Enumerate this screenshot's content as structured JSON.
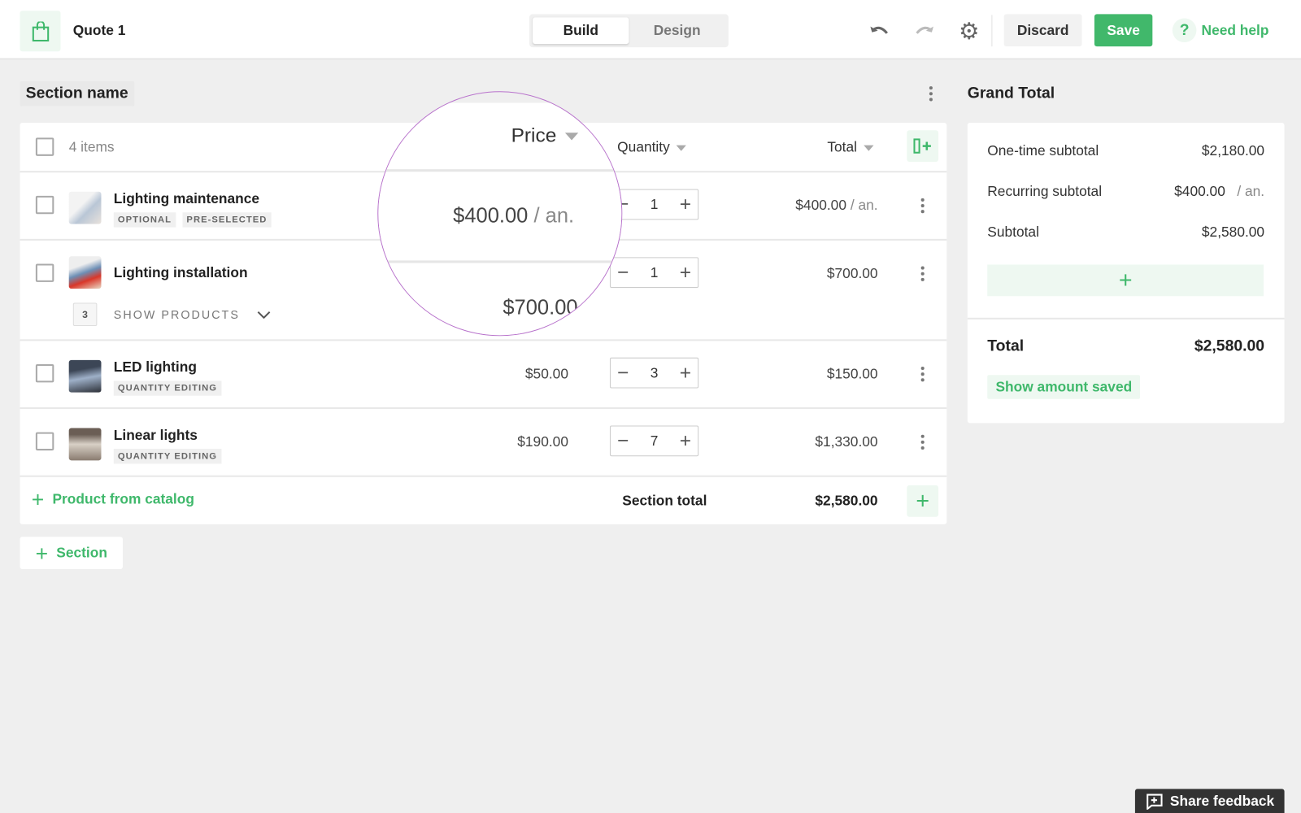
{
  "header": {
    "title": "Quote 1",
    "tabs": [
      {
        "label": "Build",
        "active": true
      },
      {
        "label": "Design",
        "active": false
      }
    ],
    "discard": "Discard",
    "save": "Save",
    "help": "Need help",
    "help_icon": "?"
  },
  "section": {
    "name": "Section name",
    "items_count": "4 items",
    "columns": {
      "price": "Price",
      "quantity": "Quantity",
      "total": "Total"
    },
    "rows": [
      {
        "name": "Lighting maintenance",
        "tags": [
          "OPTIONAL",
          "PRE-SELECTED"
        ],
        "price": "$400.00",
        "price_suffix": "/ an.",
        "qty": "1",
        "total": "$400.00",
        "total_suffix": "/ an."
      },
      {
        "name": "Lighting installation",
        "price": "$700.00",
        "qty": "1",
        "total": "$700.00",
        "bundle_count": "3",
        "show_products": "SHOW PRODUCTS"
      },
      {
        "name": "LED lighting",
        "tags": [
          "QUANTITY EDITING"
        ],
        "price": "$50.00",
        "qty": "3",
        "total": "$150.00"
      },
      {
        "name": "Linear lights",
        "tags": [
          "QUANTITY EDITING"
        ],
        "price": "$190.00",
        "qty": "7",
        "total": "$1,330.00"
      }
    ],
    "add_product": "Product from catalog",
    "section_total_label": "Section total",
    "section_total": "$2,580.00",
    "add_section": "Section"
  },
  "grand_total": {
    "title": "Grand Total",
    "one_time_label": "One-time subtotal",
    "one_time": "$2,180.00",
    "recurring_label": "Recurring subtotal",
    "recurring": "$400.00",
    "recurring_suffix": "/ an.",
    "subtotal_label": "Subtotal",
    "subtotal": "$2,580.00",
    "total_label": "Total",
    "total": "$2,580.00",
    "show_saved": "Show amount saved"
  },
  "feedback": "Share feedback",
  "colors": {
    "accent": "#41b86b",
    "lens": "#b872cc"
  }
}
